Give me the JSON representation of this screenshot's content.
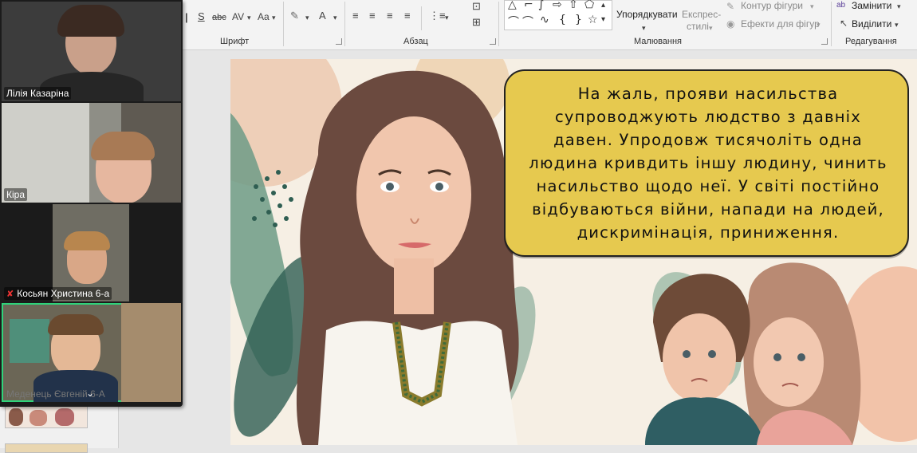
{
  "ribbon": {
    "font_group_label": "Шрифт",
    "paragraph_group_label": "Абзац",
    "drawing_group_label": "Малювання",
    "editing_group_label": "Редагування",
    "arrange_label": "Упорядкувати",
    "quick_styles_label_1": "Експрес-",
    "quick_styles_label_2": "стилі",
    "shape_outline_label": "Контур фігури",
    "shape_effects_label": "Ефекти для фігур",
    "replace_label": "Замінити",
    "select_label": "Виділити",
    "char_spacing_glyph": "AV",
    "change_case_glyph": "Aa",
    "font_color_glyph": "A",
    "strike_glyph": "abc",
    "shadow_glyph": "S"
  },
  "slide": {
    "speech_text": "На жаль, прояви насильства супроводжують людство з давніх давен. Упродовж тисячоліть одна людина кривдить іншу людину, чинить насильство щодо неї. У світі постійно відбуваються війни, напади на людей, дискримінація, приниження."
  },
  "participants": [
    {
      "name": "Лілія Казаріна",
      "muted": false
    },
    {
      "name": "Кіра",
      "muted": false
    },
    {
      "name": "Косьян Христина 6-а",
      "muted": true
    },
    {
      "name": "Меденець Євгеній 6-А",
      "muted": false,
      "active_speaker": true
    }
  ],
  "colors": {
    "speech_bubble": "#e6c94f",
    "active_speaker_border": "#2fd27a",
    "muted_icon": "#e33333"
  },
  "icons": {
    "mic_muted": "mic-muted-icon",
    "chevron": "chevron-down-icon"
  }
}
